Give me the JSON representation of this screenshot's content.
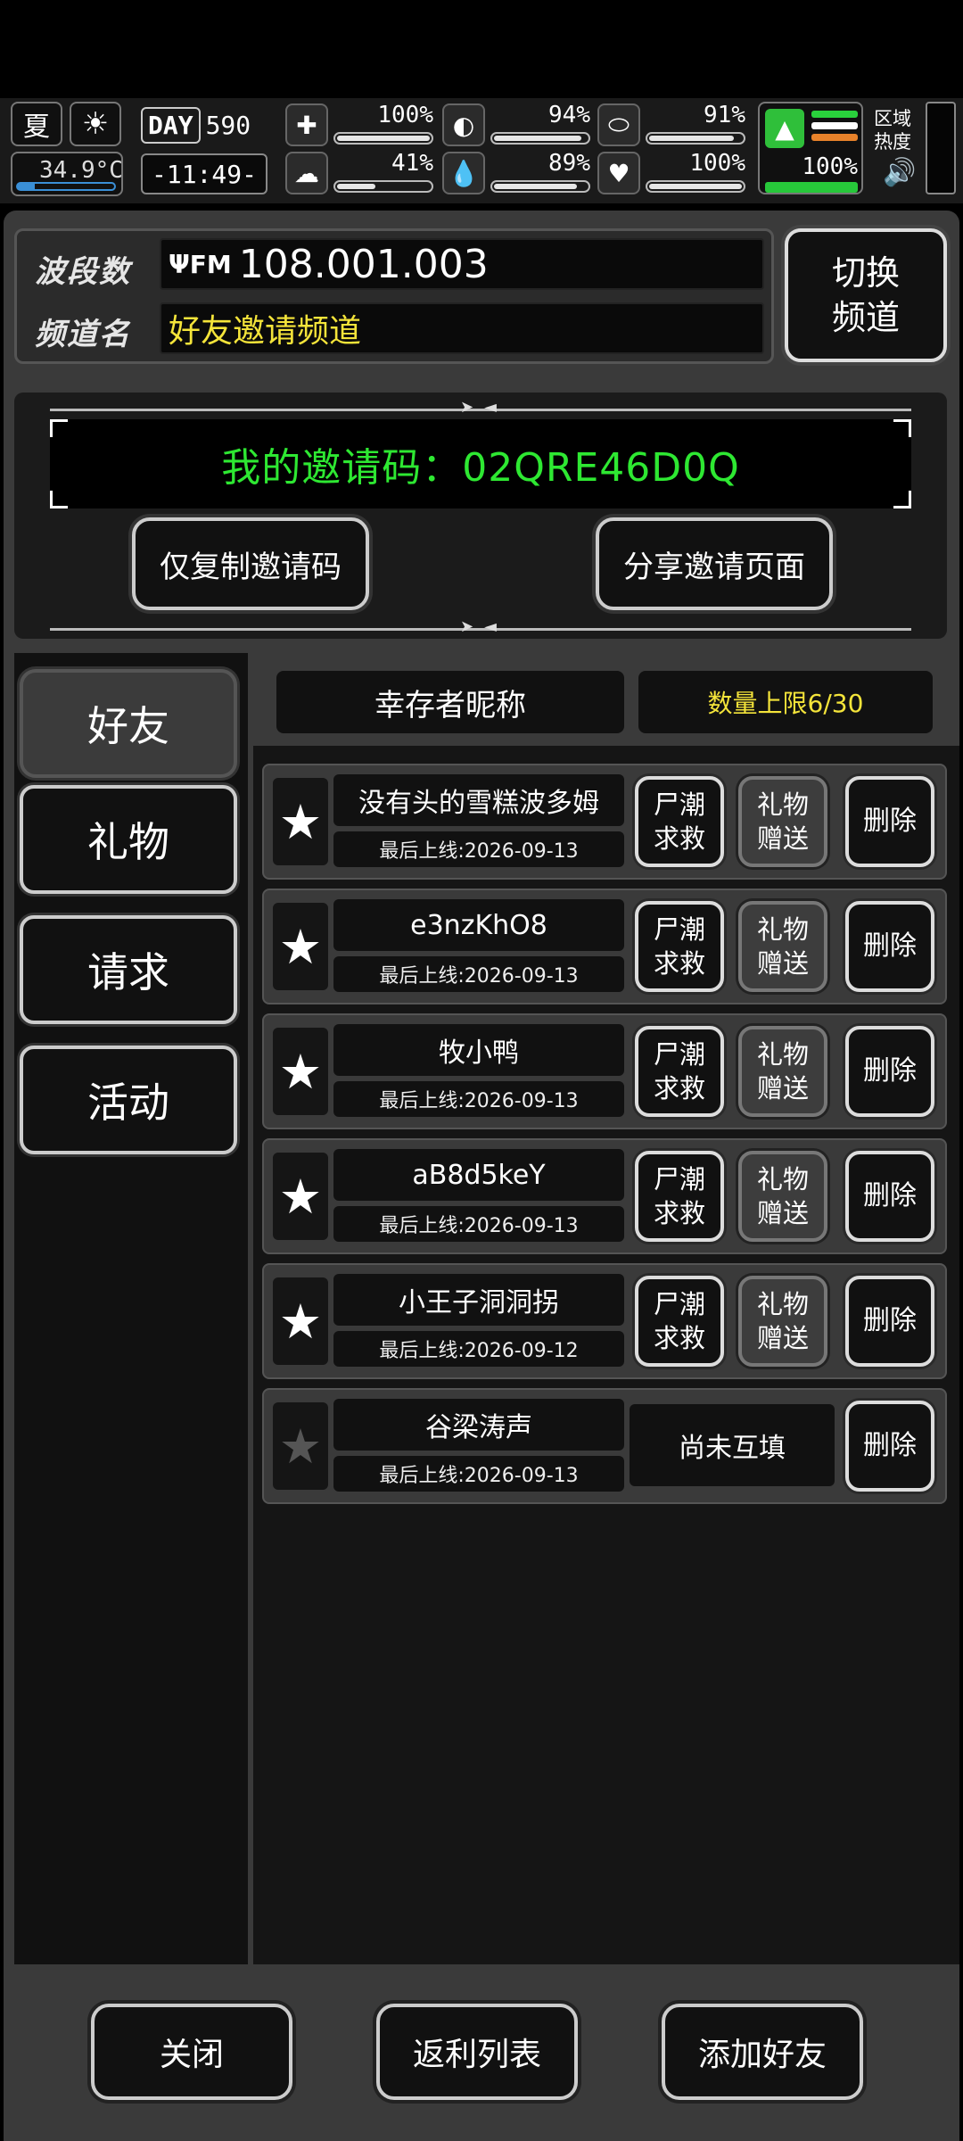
{
  "hud": {
    "season": "夏",
    "temperature": "34.9°C",
    "temperature_level": 0.18,
    "day_label": "DAY",
    "day_number": "590",
    "clock": "-11:49-",
    "stats": [
      {
        "icon": "medkit-icon",
        "glyph": "✚",
        "percent": "100%",
        "level": 1.0
      },
      {
        "icon": "stomach-icon",
        "glyph": "◐",
        "percent": "94%",
        "level": 0.94
      },
      {
        "icon": "pill-icon",
        "glyph": "⬭",
        "percent": "91%",
        "level": 0.91
      },
      {
        "icon": "brain-icon",
        "glyph": "☁",
        "percent": "41%",
        "level": 0.41
      },
      {
        "icon": "water-drop-icon",
        "glyph": "💧",
        "percent": "89%",
        "level": 0.89
      },
      {
        "icon": "heart-icon",
        "glyph": "♥",
        "percent": "100%",
        "level": 1.0
      }
    ],
    "zombie_percent": "100%",
    "area_heat_label": "区域热度",
    "colors": {
      "zombie_green": "#2fbf3a",
      "stripe_green": "#29d13c",
      "stripe_white": "#ffffff",
      "stripe_orange": "#e8822a"
    }
  },
  "radio": {
    "band_label": "波段数",
    "band_icon_text": "FM",
    "frequency": "108.001.003",
    "channel_label": "频道名",
    "channel_name": "好友邀请频道",
    "switch_button": "切换\n频道"
  },
  "invite": {
    "code_text": "我的邀请码：02QRE46D0Q",
    "copy_button": "仅复制邀请码",
    "share_button": "分享邀请页面"
  },
  "tabs": [
    "好友",
    "礼物",
    "请求",
    "活动"
  ],
  "list_header": {
    "nickname_label": "幸存者昵称",
    "limit_label": "数量上限6/30"
  },
  "friends": [
    {
      "name": "没有头的雪糕波多姆",
      "last_online": "最后上线:2026-09-13",
      "starred": true,
      "mutual": true
    },
    {
      "name": "e3nzKhO8",
      "last_online": "最后上线:2026-09-13",
      "starred": true,
      "mutual": true
    },
    {
      "name": "牧小鸭",
      "last_online": "最后上线:2026-09-13",
      "starred": true,
      "mutual": true
    },
    {
      "name": "aB8d5keY",
      "last_online": "最后上线:2026-09-13",
      "starred": true,
      "mutual": true
    },
    {
      "name": "小王子洞洞拐",
      "last_online": "最后上线:2026-09-12",
      "starred": true,
      "mutual": true
    },
    {
      "name": "谷梁涛声",
      "last_online": "最后上线:2026-09-13",
      "starred": false,
      "mutual": false
    }
  ],
  "row_buttons": {
    "rescue": "尸潮\n求救",
    "gift": "礼物\n赠送",
    "delete": "删除",
    "pending": "尚未互填"
  },
  "footer": {
    "close": "关闭",
    "rebate": "返利列表",
    "add_friend": "添加好友"
  }
}
